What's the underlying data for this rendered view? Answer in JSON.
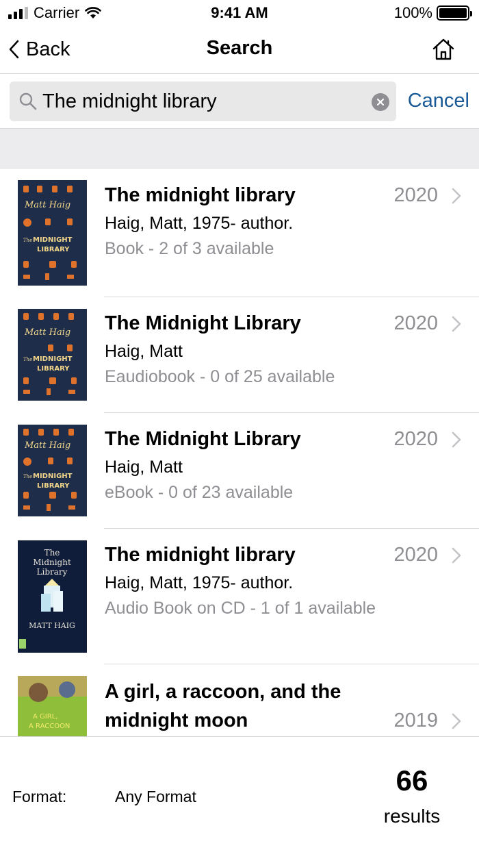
{
  "status_bar": {
    "carrier": "Carrier",
    "time": "9:41 AM",
    "battery": "100%"
  },
  "nav": {
    "back_label": "Back",
    "title": "Search",
    "home_icon": "home-icon"
  },
  "search": {
    "value": "The midnight library",
    "cancel_label": "Cancel"
  },
  "colors": {
    "accent": "#1a5a96",
    "secondary_text": "#8e8e93",
    "band": "#ececee"
  },
  "results": [
    {
      "title": "The midnight library",
      "author": "Haig, Matt, 1975- author.",
      "format": "Book - 2 of 3 available",
      "year": "2020",
      "cover": "midnight-library-cover-icon"
    },
    {
      "title": "The Midnight Library",
      "author": "Haig, Matt",
      "format": "Eaudiobook - 0 of 25 available",
      "year": "2020",
      "cover": "midnight-library-cover-icon"
    },
    {
      "title": "The Midnight Library",
      "author": "Haig, Matt",
      "format": "eBook - 0 of 23 available",
      "year": "2020",
      "cover": "midnight-library-cover-icon"
    },
    {
      "title": "The midnight library",
      "author": "Haig, Matt, 1975- author.",
      "format": "Audio Book on CD - 1 of 1 available",
      "year": "2020",
      "cover": "midnight-library-cd-cover-icon"
    },
    {
      "title_line1": "A girl, a raccoon, and the",
      "title_line2": "midnight moon",
      "year": "2019",
      "cover": "girl-raccoon-cover-icon"
    }
  ],
  "footer": {
    "format_label": "Format:",
    "format_value": "Any Format",
    "count": "66",
    "count_unit": "results"
  }
}
